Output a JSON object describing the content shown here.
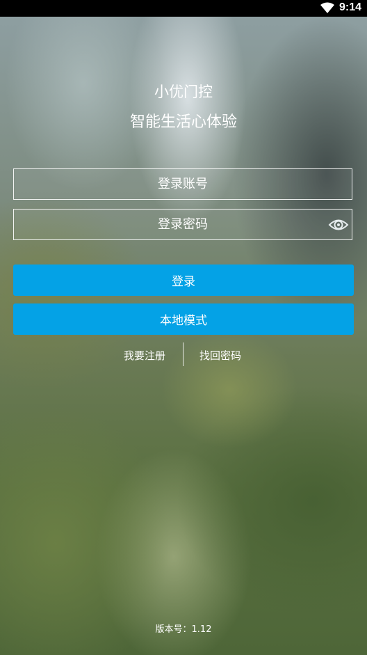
{
  "status_bar": {
    "time": "9:14",
    "icons": [
      "wifi-icon"
    ]
  },
  "app": {
    "title": "小优门控",
    "subtitle": "智能生活心体验"
  },
  "form": {
    "username_placeholder": "登录账号",
    "password_placeholder": "登录密码",
    "password_toggle_icon": "eye-icon"
  },
  "buttons": {
    "login_label": "登录",
    "local_mode_label": "本地模式"
  },
  "links": {
    "register_label": "我要注册",
    "forgot_password_label": "找回密码"
  },
  "footer": {
    "version_text": "版本号：1.12"
  },
  "colors": {
    "accent": "#04a2e6",
    "status_bar": "#000000",
    "text": "#ffffff"
  }
}
